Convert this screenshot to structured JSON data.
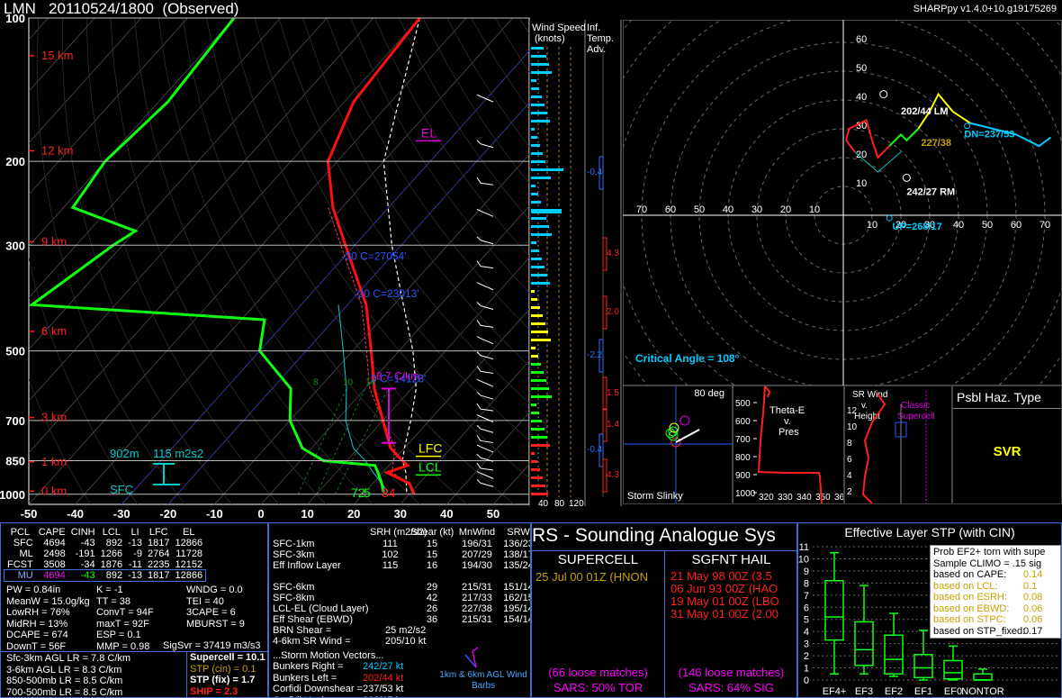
{
  "header": {
    "title": "LMN   20110524/1800  (Observed)",
    "version": "SHARPpy v1.4.0+10.g19175269"
  },
  "chart_data": [
    {
      "type": "line",
      "name": "skewt",
      "pressure_ticks": [
        100,
        200,
        300,
        500,
        700,
        850,
        1000
      ],
      "temp_ticks": [
        -50,
        -40,
        -30,
        -20,
        -10,
        0,
        10,
        20,
        30,
        40,
        50
      ],
      "height_labels": [
        "15 km",
        "12 km",
        "9 km",
        "6 km",
        "3 km",
        "1 km",
        "0 km"
      ],
      "height_pressures": [
        120,
        190,
        295,
        455,
        690,
        855,
        985
      ],
      "temperature": [
        [
          100,
          -60
        ],
        [
          150,
          -58
        ],
        [
          200,
          -52
        ],
        [
          250,
          -42
        ],
        [
          300,
          -32
        ],
        [
          400,
          -16
        ],
        [
          500,
          -6
        ],
        [
          600,
          2
        ],
        [
          700,
          10
        ],
        [
          800,
          17
        ],
        [
          850,
          22
        ],
        [
          870,
          24
        ],
        [
          900,
          21
        ],
        [
          950,
          28
        ],
        [
          1000,
          31
        ]
      ],
      "virtual_temp": [
        [
          250,
          -43
        ],
        [
          300,
          -33
        ],
        [
          400,
          -17
        ],
        [
          500,
          -7
        ],
        [
          600,
          1
        ],
        [
          700,
          10
        ],
        [
          800,
          18
        ],
        [
          900,
          22
        ],
        [
          950,
          28
        ],
        [
          990,
          30
        ]
      ],
      "dewpoint": [
        [
          100,
          -100
        ],
        [
          150,
          -98
        ],
        [
          200,
          -100
        ],
        [
          250,
          -98
        ],
        [
          280,
          -80
        ],
        [
          300,
          -82
        ],
        [
          400,
          -88
        ],
        [
          430,
          -35
        ],
        [
          500,
          -30
        ],
        [
          600,
          -16
        ],
        [
          700,
          -10
        ],
        [
          800,
          -2
        ],
        [
          850,
          5
        ],
        [
          870,
          17
        ],
        [
          900,
          19
        ],
        [
          950,
          22
        ],
        [
          990,
          24
        ]
      ],
      "parcel": [
        [
          100,
          -60
        ],
        [
          200,
          -40
        ],
        [
          300,
          -22
        ],
        [
          400,
          -8
        ],
        [
          500,
          3
        ],
        [
          600,
          11
        ],
        [
          700,
          16
        ],
        [
          800,
          20
        ],
        [
          850,
          22
        ],
        [
          900,
          25
        ],
        [
          990,
          29
        ]
      ],
      "wetbulb": [
        [
          400,
          -22
        ],
        [
          500,
          -12
        ],
        [
          600,
          -4
        ],
        [
          700,
          2
        ],
        [
          800,
          9
        ],
        [
          850,
          14
        ],
        [
          900,
          18
        ],
        [
          990,
          25
        ]
      ],
      "iso_lines": [
        {
          "label": "-30 C=27054'",
          "p": 322,
          "t": -30
        },
        {
          "label": "-20 C=23013'",
          "p": 386,
          "t": -20
        },
        {
          "label": "0 C=14128'",
          "p": 582,
          "t": 0
        }
      ],
      "levels": {
        "EL": {
          "label": "EL",
          "p": 178
        },
        "LFC": {
          "label": "LFC",
          "p": 818
        },
        "LCL": {
          "label": "LCL",
          "p": 895
        }
      },
      "lapse_label": "8.7 C/km",
      "mixing_labels": [
        "8",
        "10",
        "14"
      ],
      "sfc_labels": {
        "sfc": "SFC",
        "lcl_h": "902m",
        "srh": "115 m2s2",
        "td_sfc": "72",
        "t_sfc": "84",
        "dew_label": "5"
      }
    },
    {
      "type": "bar",
      "name": "wind-speed",
      "title": "Wind Speed (knots)",
      "ticks": [
        "40",
        "80",
        "120"
      ]
    },
    {
      "type": "bar",
      "name": "inferred-temp-adv",
      "title": "Inf. Temp. Adv.",
      "labels": [
        "-0.4",
        "4.3",
        "2.0",
        "-2.2",
        "1.5",
        "1.4",
        "-0.4",
        "4.3"
      ]
    },
    {
      "type": "line",
      "name": "hodograph",
      "x_ticks": [
        "70",
        "60",
        "50",
        "40",
        "30",
        "20",
        "10"
      ],
      "y_ticks": [
        "60",
        "50",
        "40",
        "30",
        "20",
        "10"
      ],
      "x_ticks_pos": [
        "10",
        "20",
        "30",
        "40",
        "50",
        "60",
        "70"
      ],
      "annotations": {
        "lm": "202/44 LM",
        "rm": "242/27 RM",
        "mean": "227/38",
        "dn": "DN=237/53",
        "up": "UP=268/17",
        "critical": "Critical Angle = 108°"
      }
    }
  ],
  "slinky": {
    "title": "80 deg",
    "label": "Storm Slinky"
  },
  "thetae": {
    "title": "Theta-E v. Pres",
    "p_ticks": [
      "500",
      "600",
      "700",
      "800",
      "900",
      "1000"
    ],
    "t_ticks": [
      "320",
      "330",
      "340",
      "350",
      "360"
    ]
  },
  "srwind": {
    "title": "SR Wind v. Height",
    "sub": "Classic Supercell",
    "ticks": [
      "12",
      "10",
      "8",
      "6",
      "4",
      "2"
    ]
  },
  "haz": {
    "title": "Psbl Haz. Type",
    "value": "SVR"
  },
  "thermo": {
    "headers": [
      "PCL",
      "CAPE",
      "CINH",
      "LCL",
      "LI",
      "LFC",
      "EL"
    ],
    "rows": [
      [
        "SFC",
        "4694",
        "-43",
        "892",
        "-13",
        "1817",
        "12866"
      ],
      [
        "ML",
        "2498",
        "-191",
        "1266",
        "-9",
        "2764",
        "11728"
      ],
      [
        "FCST",
        "3508",
        "-34",
        "1876",
        "-11",
        "2235",
        "12152"
      ],
      [
        "MU",
        "4694",
        "-43",
        "892",
        "-13",
        "1817",
        "12866"
      ]
    ],
    "idx_col1": [
      "PW = 0.84in",
      "MeanW = 15.0g/kg",
      "LowRH = 76%",
      "MidRH = 13%",
      "DCAPE = 674",
      "DownT = 56F"
    ],
    "idx_col2": [
      "K = -1",
      "TT = 38",
      "ConvT = 94F",
      "maxT = 92F",
      "ESP = 0.1",
      "MMP = 0.98"
    ],
    "idx_col3": [
      "WNDG = 0.0",
      "TEI = 40",
      "3CAPE = 6",
      "MBURST = 9",
      "",
      ""
    ],
    "sigsvr": "SigSvr = 37419 m3/s3",
    "lapse": [
      "Sfc-3km AGL LR = 7.8 C/km",
      "3-6km AGL LR = 8.3 C/km",
      "850-500mb LR = 8.5 C/km",
      "700-500mb LR = 8.5 C/km"
    ],
    "params": {
      "supercell": "Supercell = 10.1",
      "stp_cin": "STP (cin) = 0.1",
      "stp_fix": "STP (fix) = 1.7",
      "ship": "SHIP = 2.3"
    }
  },
  "kinematic": {
    "headers": [
      "SRH (m2/s2)",
      "Shear (kt)",
      "MnWind",
      "SRW"
    ],
    "rows": [
      [
        "SFC-1km",
        "111",
        "15",
        "196/31",
        "136/23"
      ],
      [
        "SFC-3km",
        "102",
        "15",
        "207/29",
        "138/17"
      ],
      [
        "Eff Inflow Layer",
        "115",
        "16",
        "194/30",
        "135/24"
      ],
      [
        "",
        "",
        "",
        "",
        ""
      ],
      [
        "SFC-6km",
        "",
        "29",
        "215/31",
        "151/14"
      ],
      [
        "SFC-8km",
        "",
        "42",
        "217/33",
        "162/15"
      ],
      [
        "LCL-EL (Cloud Layer)",
        "",
        "26",
        "227/38",
        "195/14"
      ],
      [
        "Eff Shear (EBWD)",
        "",
        "36",
        "215/31",
        "154/14"
      ]
    ],
    "brn": [
      "BRN Shear =",
      "25 m2/s2"
    ],
    "srw46": [
      "4-6km SR Wind =",
      "205/10 kt"
    ],
    "motion_title": "...Storm Motion Vectors...",
    "motions": [
      [
        "Bunkers Right =",
        "242/27 kt"
      ],
      [
        "Bunkers Left =",
        "202/44 kt"
      ],
      [
        "Corfidi Downshear =",
        "237/53 kt"
      ],
      [
        "Corfidi Upshear =",
        "268/17 kt"
      ]
    ],
    "barb_label": "1km & 6km AGL Wind Barbs"
  },
  "sars": {
    "title": "RS - Sounding Analogue Sys",
    "supercell_title": "SUPERCELL",
    "supercell_matches": [
      "25 Jul 00 01Z (HNON"
    ],
    "supercell_loose": "(66 loose matches)",
    "supercell_result": "SARS: 50% TOR",
    "hail_title": "SGFNT HAIL",
    "hail_matches": [
      "21 May 98 00Z (3.5",
      "06 Jun 93 00Z (HAO",
      "19 May 01 00Z (LBO",
      "31 May 01 00Z (2.00"
    ],
    "hail_loose": "(146 loose matches)",
    "hail_result": "SARS: 64% SIG"
  },
  "stp": {
    "title": "Effective Layer STP (with CIN)",
    "y_ticks": [
      "11",
      "10",
      "9",
      "8",
      "7",
      "6",
      "5",
      "4",
      "3",
      "2",
      "1",
      "0"
    ],
    "categories": [
      "EF4+",
      "EF3",
      "EF2",
      "EF1",
      "EF0",
      "NONTOR"
    ],
    "boxes": [
      {
        "lo": 0.5,
        "q1": 3.3,
        "med": 5.2,
        "q3": 8.2,
        "hi": 10.5
      },
      {
        "lo": 0.5,
        "q1": 1.2,
        "med": 2.5,
        "q3": 4.8,
        "hi": 7.8
      },
      {
        "lo": 0.3,
        "q1": 0.5,
        "med": 1.7,
        "q3": 3.7,
        "hi": 5.5
      },
      {
        "lo": 0.0,
        "q1": 0.2,
        "med": 1.0,
        "q3": 2.1,
        "hi": 4.1
      },
      {
        "lo": 0.0,
        "q1": 0.1,
        "med": 0.6,
        "q3": 1.6,
        "hi": 2.8
      },
      {
        "lo": 0.0,
        "q1": 0.0,
        "med": 0.0,
        "q3": 0.5,
        "hi": 0.9
      }
    ],
    "legend": [
      "Prob EF2+ torn with supe",
      "Sample CLIMO = .15 sig",
      "based on CAPE:",
      "based on LCL:",
      "based on ESRH:",
      "based on EBWD:",
      "based on STPC:",
      "based on STP_fixed:"
    ],
    "legend_vals": [
      "",
      "",
      "0.14",
      "0.1",
      "0.08",
      "0.06",
      "0.06",
      "0.17"
    ]
  }
}
